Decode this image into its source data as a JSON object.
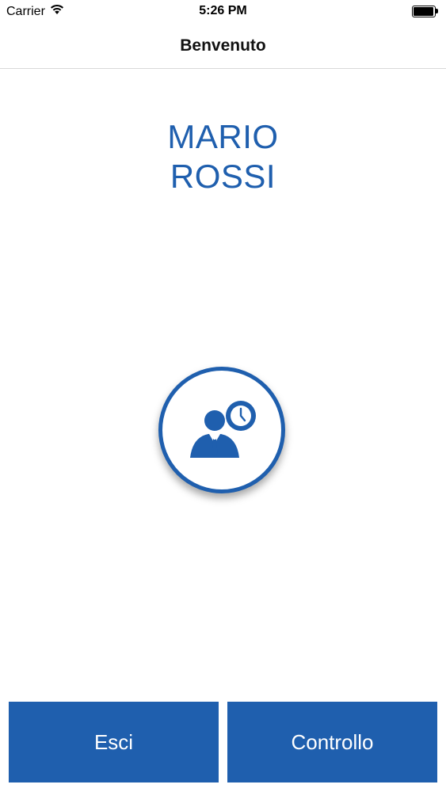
{
  "status_bar": {
    "carrier": "Carrier",
    "time": "5:26 PM",
    "wifi_icon": "wifi-icon",
    "battery_icon": "battery-icon"
  },
  "nav": {
    "title": "Benvenuto"
  },
  "user": {
    "first_name": "MARIO",
    "last_name": "ROSSI"
  },
  "main_action": {
    "icon": "employee-clock-icon"
  },
  "buttons": {
    "exit_label": "Esci",
    "check_label": "Controllo"
  },
  "colors": {
    "accent": "#1f5fae",
    "background": "#ffffff"
  }
}
